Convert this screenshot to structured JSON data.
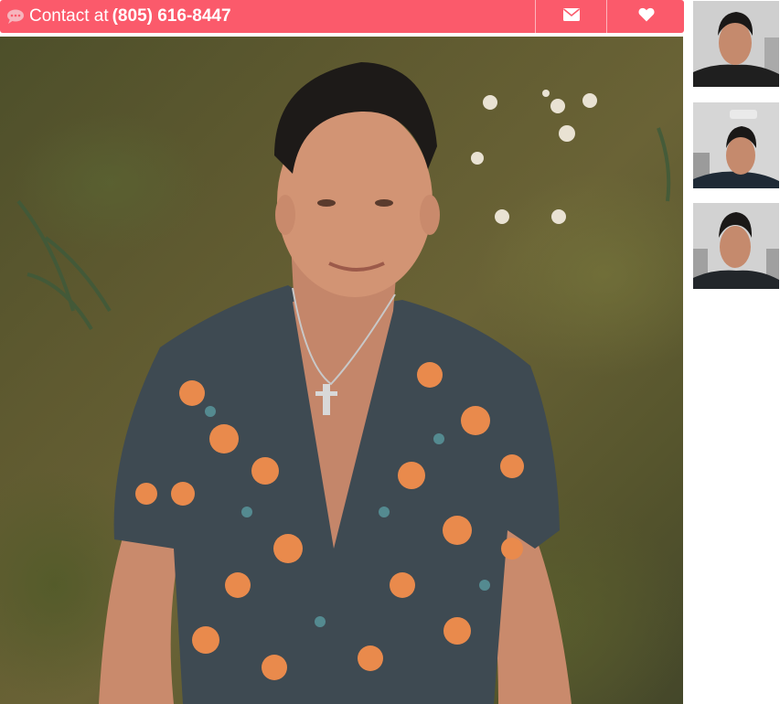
{
  "contact": {
    "prefix": "Contact at",
    "phone": "(805) 616-8447"
  },
  "icons": {
    "chat": "chat-bubble-icon",
    "email": "envelope-icon",
    "favorite": "heart-icon"
  },
  "colors": {
    "accent": "#fb5a6b",
    "icon_chat": "#f6b5bd",
    "text_on_accent": "#ffffff"
  },
  "gallery": {
    "thumbnails": [
      "thumb-1",
      "thumb-2",
      "thumb-3"
    ]
  }
}
